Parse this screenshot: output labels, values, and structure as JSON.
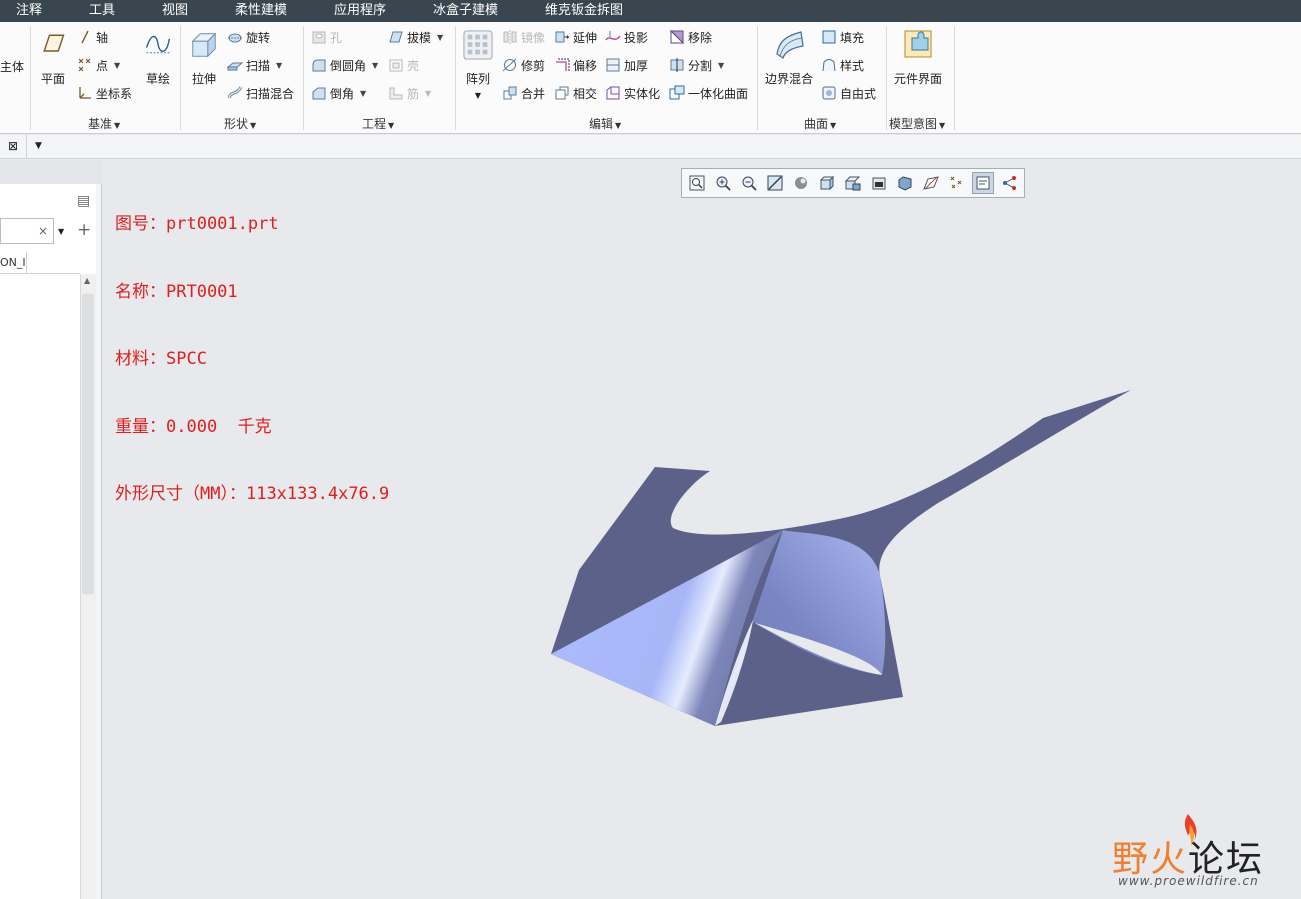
{
  "menubar": {
    "items": [
      "注释",
      "工具",
      "视图",
      "柔性建模",
      "应用程序",
      "冰盒子建模",
      "维克钣金拆图"
    ]
  },
  "ribbon": {
    "partial_left": "主体",
    "datum": {
      "plane": "平面",
      "axis": "轴",
      "point": "点",
      "csys": "坐标系",
      "sketch": "草绘",
      "group": "基准"
    },
    "shapes": {
      "extrude": "拉伸",
      "revolve": "旋转",
      "sweep": "扫描",
      "swept_blend": "扫描混合",
      "group": "形状"
    },
    "engineering": {
      "hole": "孔",
      "draft": "拔模",
      "round": "倒圆角",
      "shell": "壳",
      "chamfer": "倒角",
      "rib": "筋",
      "group": "工程"
    },
    "editing": {
      "pattern": "阵列",
      "mirror": "镜像",
      "extend": "延伸",
      "project": "投影",
      "remove": "移除",
      "trim": "修剪",
      "offset": "偏移",
      "thicken": "加厚",
      "split": "分割",
      "merge": "合并",
      "intersect": "相交",
      "solidify": "实体化",
      "unified_surface": "一体化曲面",
      "group": "编辑"
    },
    "surfaces": {
      "boundary_blend": "边界混合",
      "fill": "填充",
      "style": "样式",
      "freestyle": "自由式",
      "group": "曲面"
    },
    "model_intent": {
      "component_interface": "元件界面",
      "group": "模型意图"
    }
  },
  "left_panel": {
    "column_header": "ON_I",
    "search_value": ""
  },
  "info": {
    "lines": [
      "图号：prt0001.prt",
      "名称：PRT0001",
      "材料：SPCC",
      "重量：0.000  千克",
      "外形尺寸（MM）：113x133.4x76.9"
    ]
  },
  "view_toolbar": {
    "icons": [
      "refit-icon",
      "zoom-in-icon",
      "zoom-out-icon",
      "repaint-icon",
      "display-style-icon",
      "saved-views-icon",
      "view-manager-icon",
      "perspective-icon",
      "spin-center-icon",
      "plane-display-icon",
      "point-display-icon",
      "annotation-display-icon",
      "csys-display-icon"
    ]
  },
  "watermark": {
    "title_a": "野火",
    "title_b": "论坛",
    "url": "www.proewildfire.cn"
  },
  "colors": {
    "menubar_bg": "#39464f",
    "info_text": "#e01e1e",
    "model_dark": "#5b6189",
    "model_light": "#a9b8fb",
    "canvas_bg": "#e7e9ec"
  }
}
